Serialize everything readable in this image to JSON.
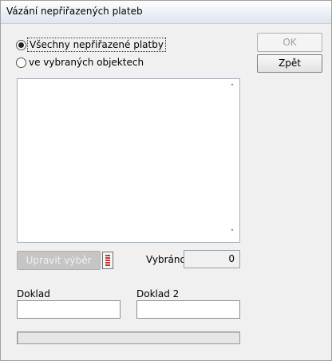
{
  "window": {
    "title": "Vázání nepřiřazených plateb"
  },
  "options": [
    {
      "label": "Všechny nepřiřazené platby",
      "checked": true
    },
    {
      "label": "ve vybraných objektech",
      "checked": false
    }
  ],
  "buttons": {
    "ok": "OK",
    "back": "Zpět",
    "edit_selection": "Upravit výběr"
  },
  "listbox": {
    "items": [],
    "scroll_up_icon": "arrow-up-icon",
    "scroll_down_icon": "arrow-down-icon"
  },
  "selected": {
    "label": "Vybráno",
    "value": "0"
  },
  "fields": {
    "doklad": {
      "label": "Doklad",
      "value": ""
    },
    "doklad2": {
      "label": "Doklad 2",
      "value": ""
    }
  },
  "progress": {
    "value": 0
  },
  "icons": {
    "edit_list": "list-icon"
  }
}
